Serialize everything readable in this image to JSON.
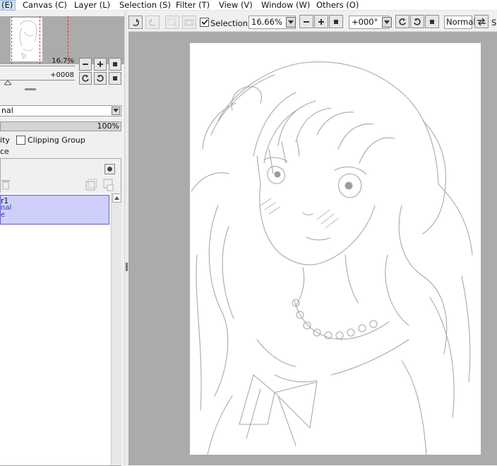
{
  "menu": {
    "edit": "(E)",
    "canvas": "Canvas (C)",
    "layer": "Layer (L)",
    "selection": "Selection (S)",
    "filter": "Filter (T)",
    "view": "View (V)",
    "window": "Window (W)",
    "others": "Others (O)"
  },
  "navigator": {
    "zoom": "16.7%",
    "rotation": "+0008"
  },
  "layer_properties": {
    "blend_mode": "nal",
    "opacity": "100%",
    "preserve_opacity_label": "ity",
    "clipping_group_label": "Clipping Group",
    "selection_source_label": "ce"
  },
  "layers": [
    {
      "name": "r1",
      "mode": "nal",
      "opacity": "e"
    }
  ],
  "toolbar": {
    "selection_label": "Selection",
    "selection_checked": true,
    "zoom_value": "16.66%",
    "rotation_value": "+000°",
    "blend_mode": "Normal",
    "cut_label": "S"
  },
  "colors": {
    "canvas_bg": "#ababab",
    "layer_selected_bg": "#cfcffb",
    "layer_selected_border": "#5b5bdc",
    "navigator_marker": "#e53030"
  },
  "icons": {
    "undo": "undo-icon",
    "redo": "redo-icon",
    "zoom_out": "minus-icon",
    "zoom_in": "plus-icon",
    "reset": "square-icon",
    "rotate_left": "rotate-left-icon",
    "rotate_right": "rotate-right-icon",
    "flip": "flip-icon"
  }
}
